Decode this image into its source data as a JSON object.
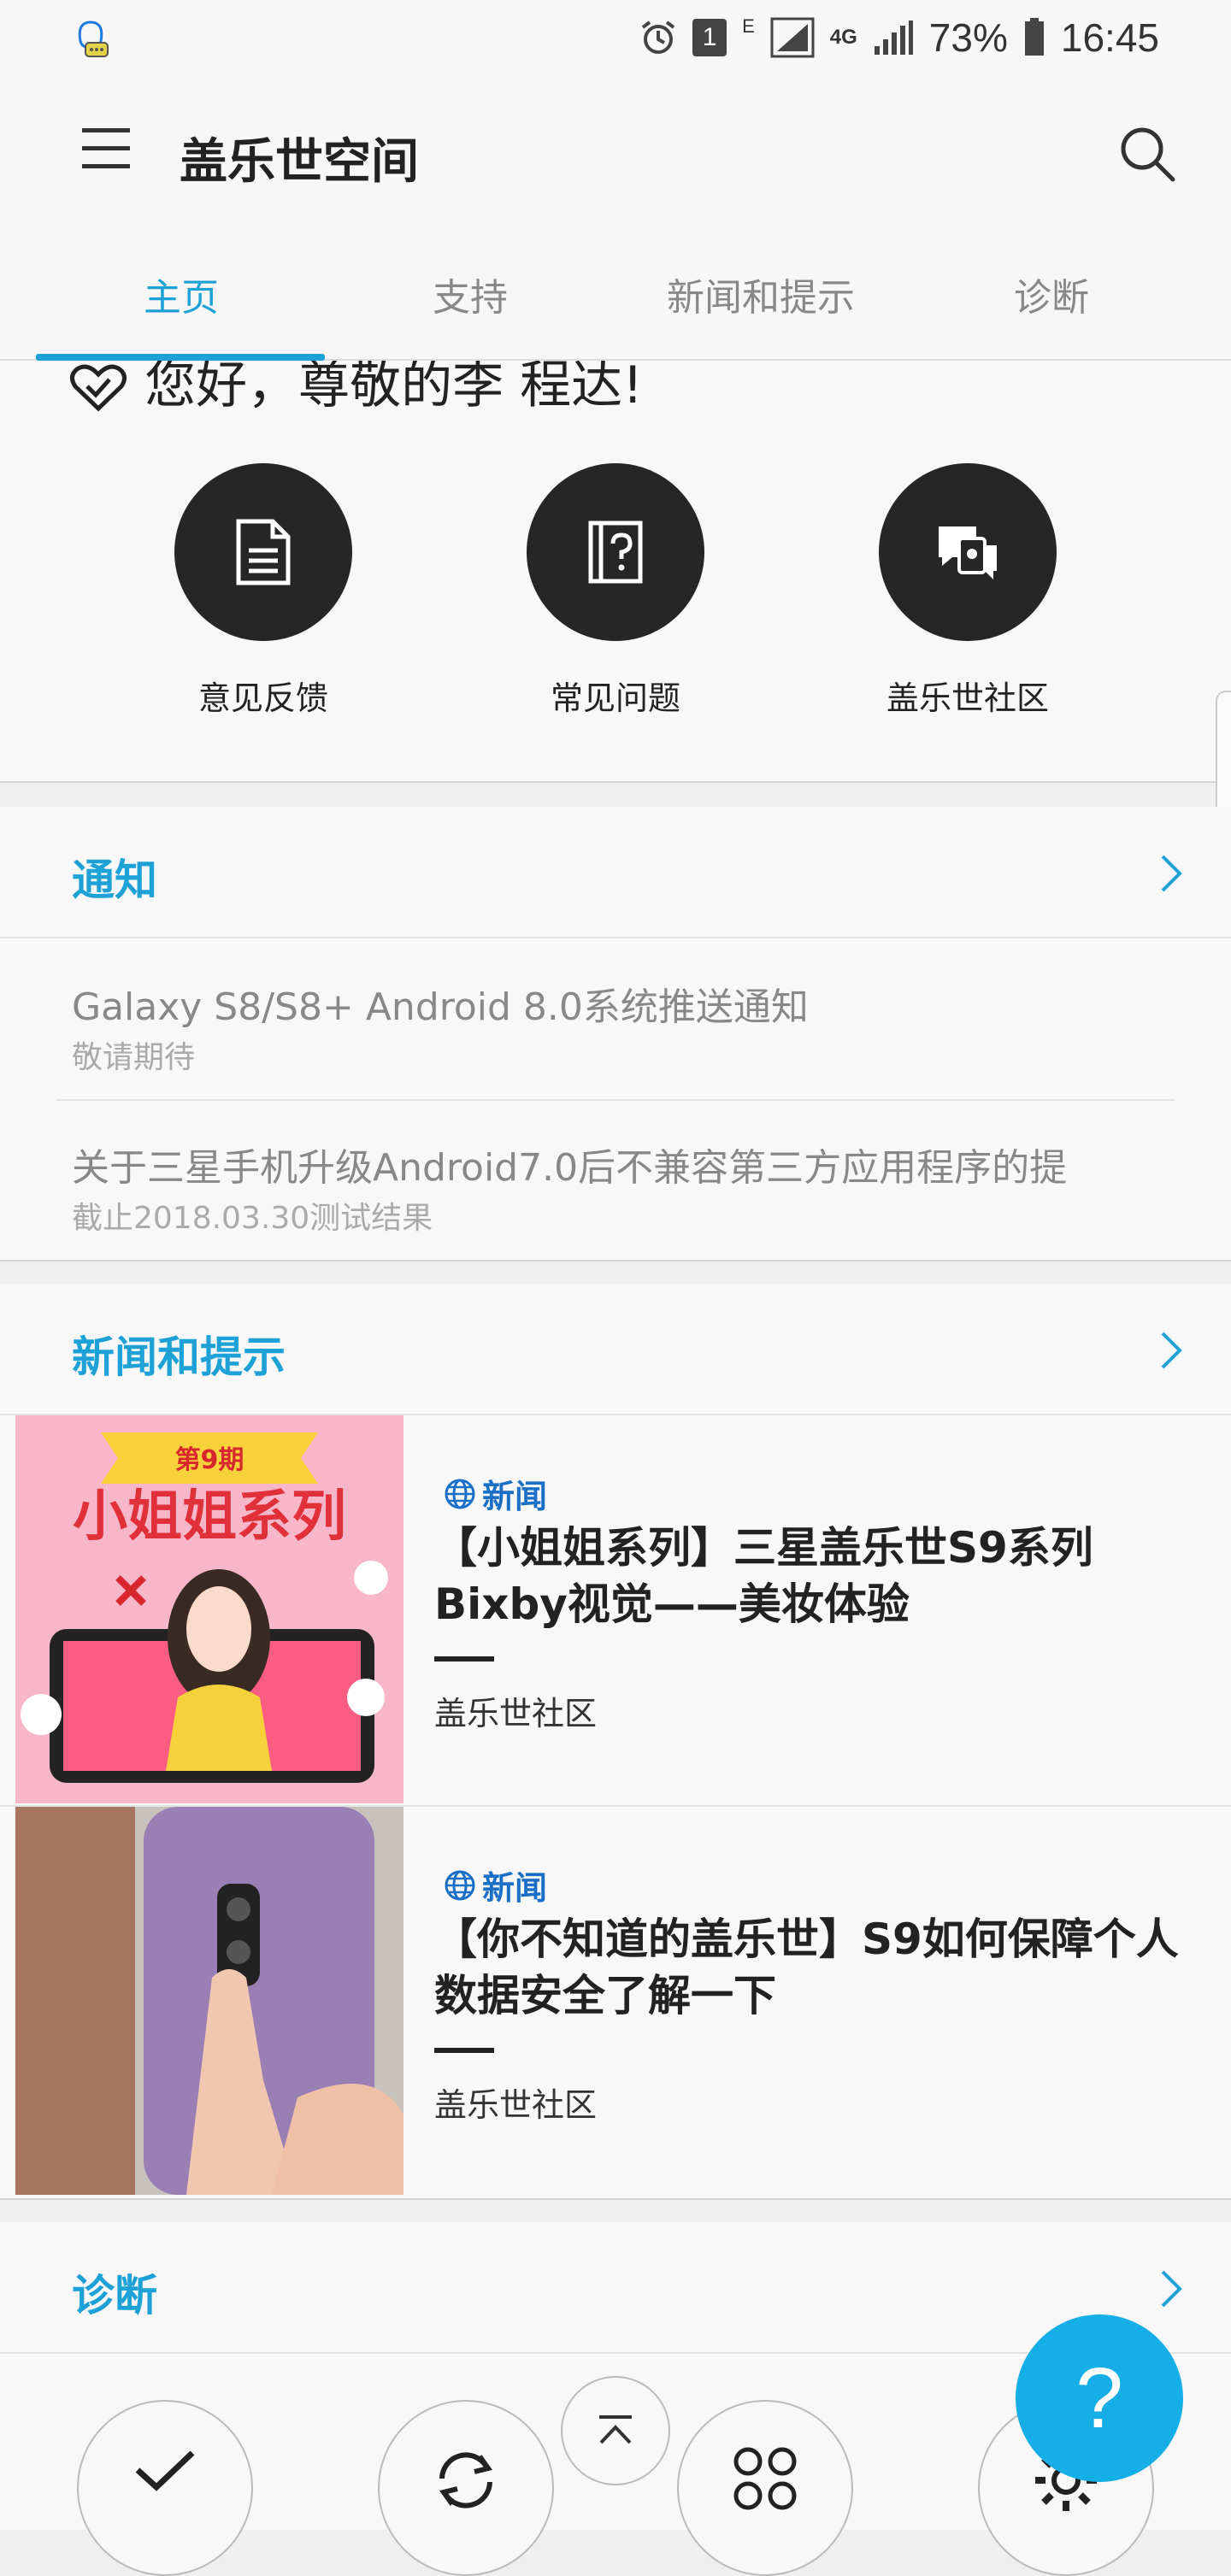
{
  "status_bar": {
    "battery": "73%",
    "time": "16:45",
    "notif_count": "1",
    "net_e": "E",
    "net_4g": "4G"
  },
  "app": {
    "title": "盖乐世空间"
  },
  "tabs": [
    "主页",
    "支持",
    "新闻和提示",
    "诊断"
  ],
  "home": {
    "greeting": "您好，尊敬的李 程达!",
    "shortcuts": [
      {
        "label": "意见反馈",
        "icon": "document-icon"
      },
      {
        "label": "常见问题",
        "icon": "question-book-icon"
      },
      {
        "label": "盖乐世社区",
        "icon": "community-chat-icon"
      }
    ]
  },
  "notifications": {
    "title": "通知",
    "items": [
      {
        "title": "Galaxy S8/S8+ Android 8.0系统推送通知",
        "subtitle": "敬请期待"
      },
      {
        "title": "关于三星手机升级Android7.0后不兼容第三方应用程序的提",
        "subtitle": "截止2018.03.30测试结果"
      }
    ]
  },
  "news": {
    "title": "新闻和提示",
    "items": [
      {
        "tag": "新闻",
        "title": "【小姐姐系列】三星盖乐世S9系列Bixby视觉——美妆体验",
        "source": "盖乐世社区",
        "image_text": {
          "badge": "第9期",
          "headline": "小姐姐系列"
        }
      },
      {
        "tag": "新闻",
        "title": "【你不知道的盖乐世】S9如何保障个人数据安全了解一下",
        "source": "盖乐世社区"
      }
    ]
  },
  "diagnostics": {
    "title": "诊断"
  },
  "fab": {
    "label": "?"
  },
  "colors": {
    "accent": "#1ea1d6",
    "fab": "#16aee6",
    "news_tag": "#1a6fc6"
  }
}
